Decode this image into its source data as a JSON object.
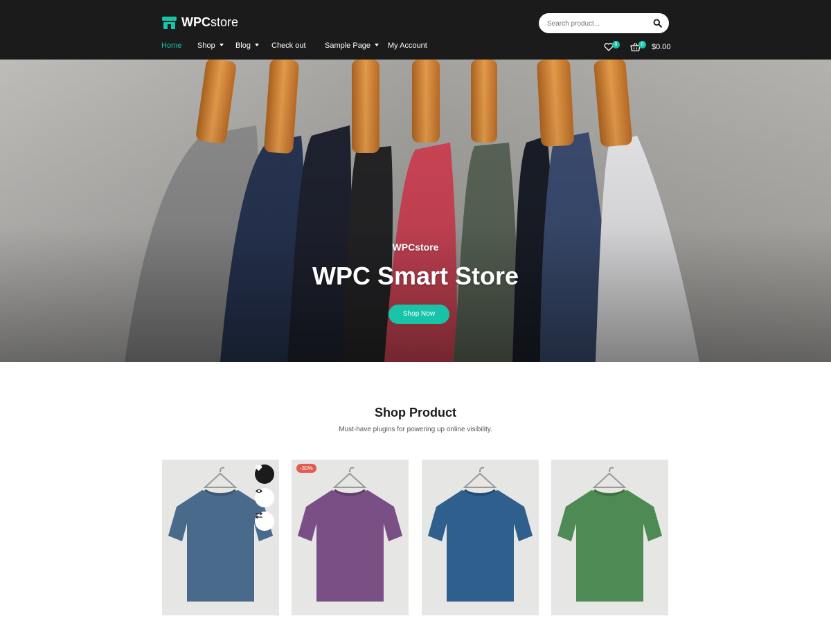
{
  "header": {
    "logo_bold": "WPC",
    "logo_rest": "store",
    "search_placeholder": "Search product...",
    "wishlist_count": "0",
    "cart_count": "0",
    "cart_total": "$0.00",
    "nav": [
      {
        "label": "Home",
        "active": true
      },
      {
        "label": "Shop",
        "dropdown": true
      },
      {
        "label": "Blog",
        "dropdown": true
      },
      {
        "label": "Check out"
      },
      {
        "label": "Sample Page",
        "dropdown": true
      },
      {
        "label": "My Account"
      }
    ]
  },
  "hero": {
    "subtitle": "WPCstore",
    "title": "WPC Smart Store",
    "button": "Shop Now"
  },
  "section": {
    "title": "Shop Product",
    "subtitle": "Must-have plugins for powering up online visibility."
  },
  "products": [
    {
      "shirt_color": "#4a6a8c",
      "icons": [
        "heart-icon",
        "eye-icon",
        "compare-icon"
      ]
    },
    {
      "shirt_color": "#7a4f86",
      "badge": "-30%"
    },
    {
      "shirt_color": "#2f5f8d"
    },
    {
      "shirt_color": "#4e8a53"
    }
  ],
  "colors": {
    "accent": "#17c4a9",
    "header_bg": "#1b1b1b",
    "sale_badge": "#e25b4f"
  }
}
